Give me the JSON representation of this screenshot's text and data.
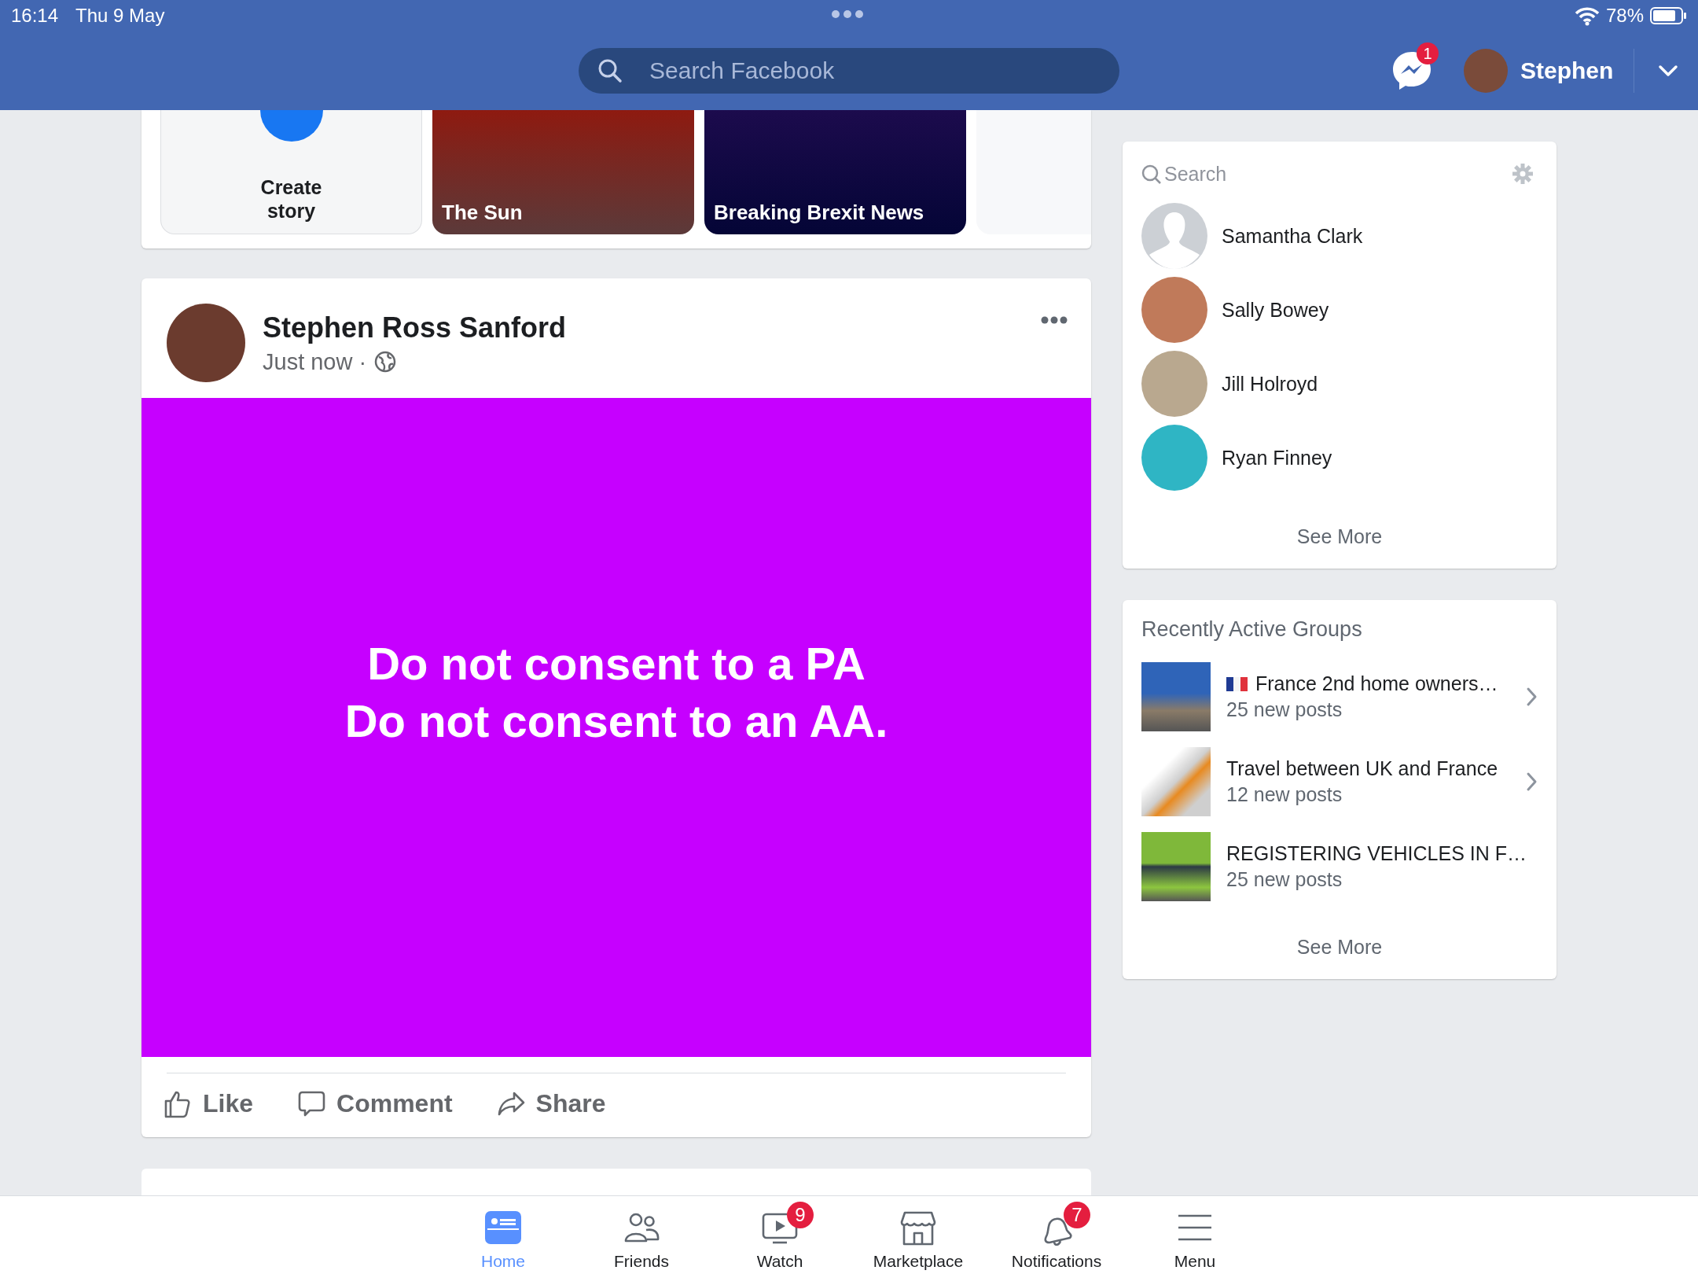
{
  "status_bar": {
    "time": "16:14",
    "date": "Thu 9 May",
    "battery": "78%"
  },
  "header": {
    "search": {
      "placeholder": "Search Facebook"
    },
    "messenger_badge": "1",
    "user_name": "Stephen"
  },
  "stories": [
    {
      "kind": "create",
      "label": "Create story"
    },
    {
      "kind": "photo",
      "label": "The Sun"
    },
    {
      "kind": "photo",
      "label": "Breaking Brexit News"
    },
    {
      "kind": "blank"
    }
  ],
  "post": {
    "author": "Stephen Ross Sanford",
    "meta": "Just now ·",
    "text": "Do not consent to a PA\nDo not consent to an AA.",
    "actions": [
      {
        "kind": "like",
        "label": "Like"
      },
      {
        "kind": "comment",
        "label": "Comment"
      },
      {
        "kind": "share",
        "label": "Share"
      }
    ]
  },
  "contacts": {
    "search": {
      "placeholder": "Search"
    },
    "people": [
      {
        "name": "Samantha Clark",
        "kind": "silhouette"
      },
      {
        "name": "Sally Bowey",
        "kind": "photo"
      },
      {
        "name": "Jill Holroyd",
        "kind": "photo"
      },
      {
        "name": "Ryan Finney",
        "kind": "photo"
      }
    ],
    "see_more": "See More"
  },
  "groups": {
    "title": "Recently Active Groups",
    "items": [
      {
        "name": "France 2nd home owners…",
        "posts": "25 new posts",
        "flag": true
      },
      {
        "name": "Travel between UK and France",
        "posts": "12 new posts",
        "flag": false
      },
      {
        "name": "REGISTERING VEHICLES IN F…",
        "posts": "25 new posts",
        "flag": false
      }
    ],
    "see_more": "See More"
  },
  "tab_bar": [
    {
      "kind": "home",
      "label": "Home",
      "selected": true
    },
    {
      "kind": "friends",
      "label": "Friends",
      "selected": false
    },
    {
      "kind": "watch",
      "label": "Watch",
      "selected": false,
      "badge": "9"
    },
    {
      "kind": "market",
      "label": "Marketplace",
      "selected": false
    },
    {
      "kind": "bell",
      "label": "Notifications",
      "selected": false,
      "badge": "7"
    },
    {
      "kind": "menu",
      "label": "Menu",
      "selected": false
    }
  ]
}
